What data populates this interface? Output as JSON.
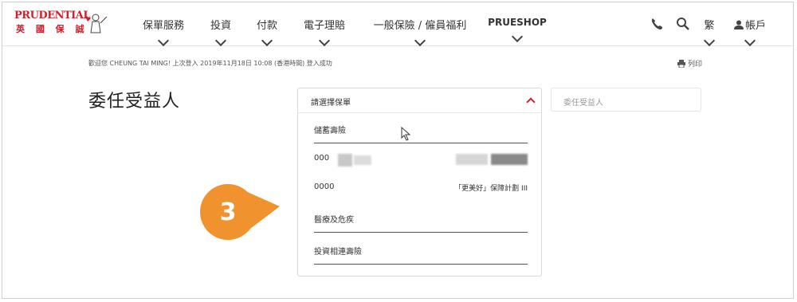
{
  "header": {
    "logo_brand": "PRUDENTIAL",
    "logo_cn": "英 國 保 誠",
    "nav": [
      "保單服務",
      "投資",
      "付款",
      "電子理賠",
      "一般保險 / 僱員福利",
      "PRUESHOP"
    ],
    "lang": "繁",
    "account": "帳戶",
    "icons": [
      "phone-icon",
      "search-icon",
      "user-icon",
      "chevron-down-icon"
    ]
  },
  "welcome": "歡迎您 CHEUNG TAI MING! 上次登入 2019年11月18日 10:08 (香港時間) 登入成功",
  "print_label": "列印",
  "page_title": "委任受益人",
  "dropdown": {
    "placeholder": "請選擇保單",
    "group1": "儲蓄壽險",
    "policy1": "000",
    "policy2": "0000",
    "policy2_name": "「更美好」保障計劃 III",
    "group2": "醫療及危疾",
    "group3": "投資相連壽險"
  },
  "beneficiary_field": "委任受益人",
  "callout_number": "3",
  "colors": {
    "brand": "#d21f2c",
    "callout": "#f0922e"
  }
}
